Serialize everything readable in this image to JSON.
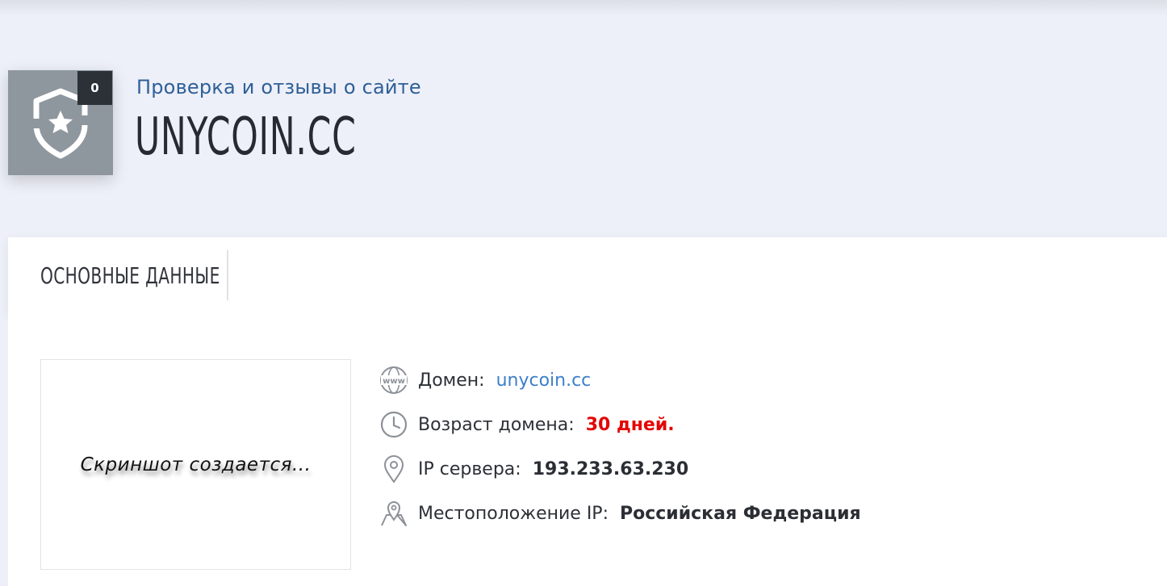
{
  "header": {
    "reviews_count": "0",
    "subtitle": "Проверка и отзывы о сайте",
    "domain_title": "UNYCOIN.CC"
  },
  "tabs": [
    {
      "label": "ОСНОВНЫЕ ДАННЫЕ"
    }
  ],
  "screenshot": {
    "placeholder_text": "Скриншот создается..."
  },
  "info": {
    "domain": {
      "label": "Домен:",
      "value": "unycoin.cc",
      "icon": "www-globe-icon"
    },
    "age": {
      "label": "Возраст домена:",
      "value": "30 дней.",
      "icon": "clock-icon",
      "color": "#e40505"
    },
    "ip": {
      "label": "IP сервера:",
      "value": "193.233.63.230",
      "icon": "map-pin-icon"
    },
    "location": {
      "label": "Местоположение IP:",
      "value": "Российская Федерация",
      "icon": "map-location-icon"
    }
  },
  "colors": {
    "page_bg": "#edf0f8",
    "badge_bg": "#8e969e",
    "count_bg": "#2c3138",
    "subtitle": "#2f5f98",
    "link": "#3d7fc9"
  }
}
